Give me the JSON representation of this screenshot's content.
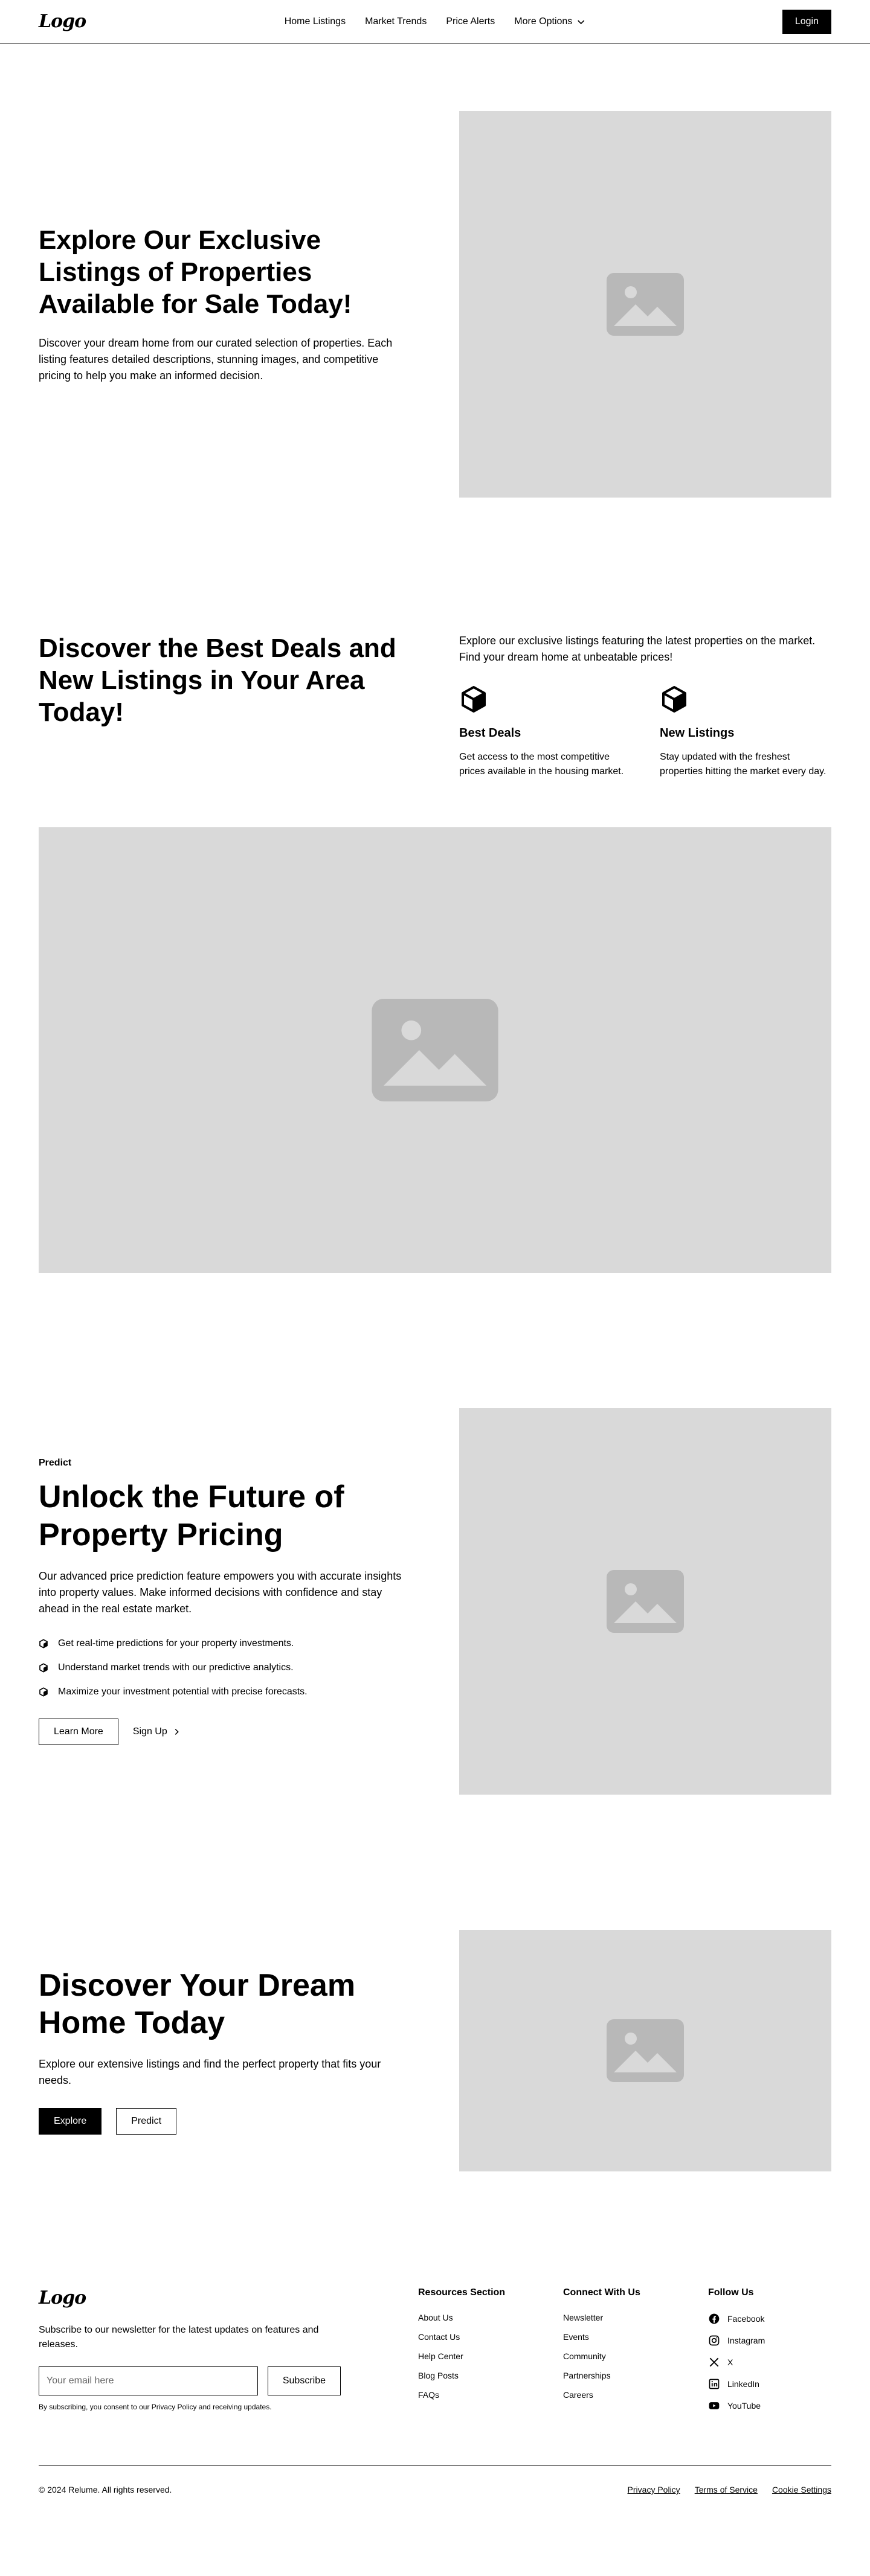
{
  "nav": {
    "logo": "Logo",
    "links": [
      "Home Listings",
      "Market Trends",
      "Price Alerts"
    ],
    "more_label": "More Options",
    "login_label": "Login"
  },
  "hero": {
    "heading": "Explore Our Exclusive Listings of Properties Available for Sale Today!",
    "body": "Discover your dream home from our curated selection of properties. Each listing features detailed descriptions, stunning images, and competitive pricing to help you make an informed decision."
  },
  "deals": {
    "heading": "Discover the Best Deals and New Listings in Your Area Today!",
    "intro": "Explore our exclusive listings featuring the latest properties on the market. Find your dream home at unbeatable prices!",
    "features": [
      {
        "title": "Best Deals",
        "body": "Get access to the most competitive prices available in the housing market."
      },
      {
        "title": "New Listings",
        "body": "Stay updated with the freshest properties hitting the market every day."
      }
    ]
  },
  "predict": {
    "tagline": "Predict",
    "heading": "Unlock the Future of Property Pricing",
    "body": "Our advanced price prediction feature empowers you with accurate insights into property values. Make informed decisions with confidence and stay ahead in the real estate market.",
    "bullets": [
      "Get real-time predictions for your property investments.",
      "Understand market trends with our predictive analytics.",
      "Maximize your investment potential with precise forecasts."
    ],
    "primary_label": "Learn More",
    "secondary_label": "Sign Up"
  },
  "cta": {
    "heading": "Discover Your Dream Home Today",
    "body": "Explore our extensive listings and find the perfect property that fits your needs.",
    "primary_label": "Explore",
    "secondary_label": "Predict"
  },
  "footer": {
    "logo": "Logo",
    "newsletter_text": "Subscribe to our newsletter for the latest updates on features and releases.",
    "email_placeholder": "Your email here",
    "subscribe_label": "Subscribe",
    "consent": "By subscribing, you consent to our Privacy Policy and receiving updates.",
    "columns": [
      {
        "title": "Resources Section",
        "links": [
          "About Us",
          "Contact Us",
          "Help Center",
          "Blog Posts",
          "FAQs"
        ]
      },
      {
        "title": "Connect With Us",
        "links": [
          "Newsletter",
          "Events",
          "Community",
          "Partnerships",
          "Careers"
        ]
      }
    ],
    "follow": {
      "title": "Follow Us",
      "links": [
        {
          "label": "Facebook",
          "icon": "facebook-icon"
        },
        {
          "label": "Instagram",
          "icon": "instagram-icon"
        },
        {
          "label": "X",
          "icon": "x-icon"
        },
        {
          "label": "LinkedIn",
          "icon": "linkedin-icon"
        },
        {
          "label": "YouTube",
          "icon": "youtube-icon"
        }
      ]
    },
    "copyright": "© 2024 Relume. All rights reserved.",
    "legal": [
      "Privacy Policy",
      "Terms of Service",
      "Cookie Settings"
    ]
  },
  "colors": {
    "accent": "#000000",
    "placeholder": "#d9d9d9",
    "placeholder_icon": "#b8b8b8",
    "background": "#ffffff"
  }
}
